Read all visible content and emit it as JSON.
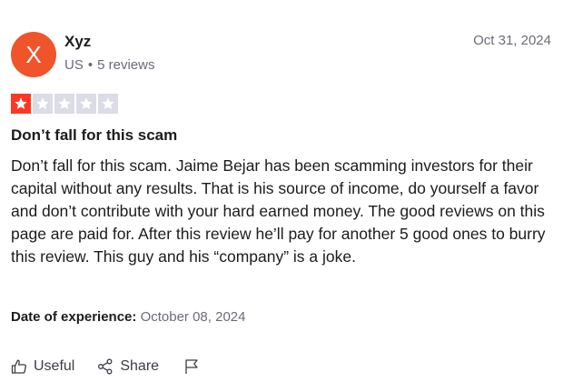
{
  "reviewer": {
    "initial": "X",
    "name": "Xyz",
    "country": "US",
    "separator": "•",
    "reviews_count": "5 reviews",
    "avatar_color": "#f0542a"
  },
  "review": {
    "date": "Oct 31, 2024",
    "rating": 1,
    "max_rating": 5,
    "star_color": "#ff3722",
    "empty_star_color": "#dcdce6",
    "title": "Don’t fall for this scam",
    "body": "Don’t fall for this scam. Jaime Bejar has been scamming investors for their capital without any results. That is his source of income, do yourself a favor and don’t contribute with your hard earned money. The good reviews on this page are paid for. After this review he’ll pay for another 5 good ones to burry this review. This guy and his “company” is a joke.",
    "experience_label": "Date of experience:",
    "experience_date": "October 08, 2024"
  },
  "actions": {
    "useful_label": "Useful",
    "useful_icon": "thumbs-up-icon",
    "share_label": "Share",
    "share_icon": "share-icon",
    "report_icon": "flag-icon"
  }
}
